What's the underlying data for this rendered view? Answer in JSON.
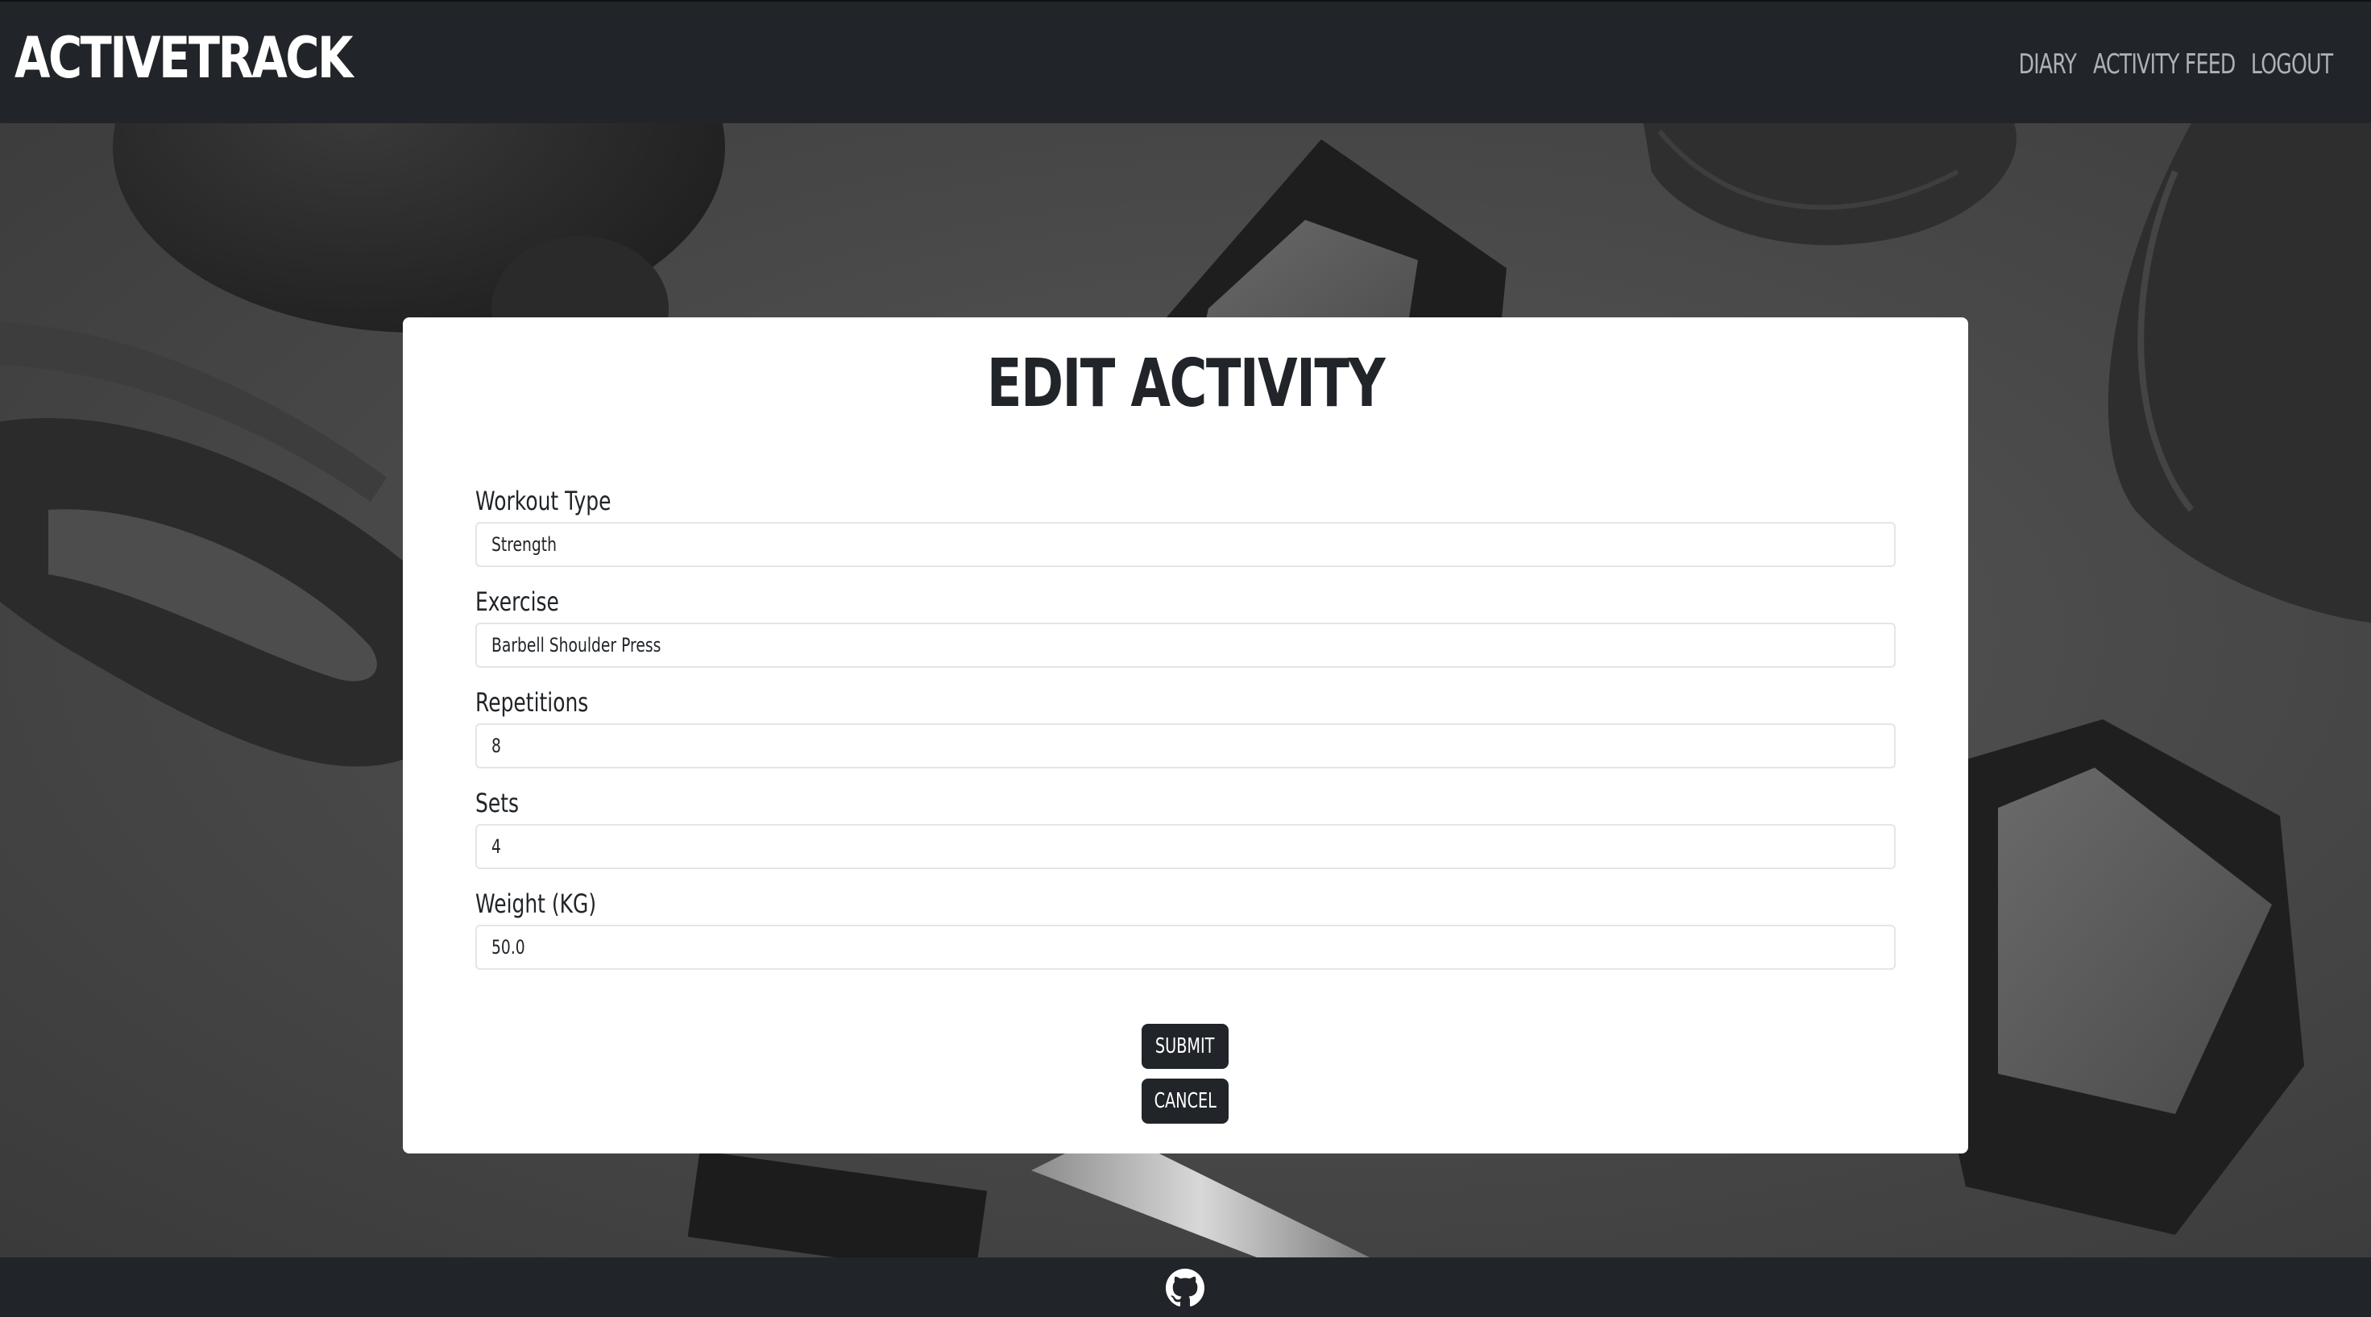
{
  "navbar": {
    "brand": "ACTIVETRACK",
    "links": [
      {
        "label": "DIARY"
      },
      {
        "label": "ACTIVITY FEED"
      },
      {
        "label": "LOGOUT"
      }
    ]
  },
  "form": {
    "title": "EDIT ACTIVITY",
    "fields": [
      {
        "label": "Workout Type",
        "value": "Strength"
      },
      {
        "label": "Exercise",
        "value": "Barbell Shoulder Press"
      },
      {
        "label": "Repetitions",
        "value": "8"
      },
      {
        "label": "Sets",
        "value": "4"
      },
      {
        "label": "Weight (KG)",
        "value": "50.0"
      }
    ],
    "submit_label": "SUBMIT",
    "cancel_label": "CANCEL"
  },
  "footer": {
    "icon": "github-icon"
  },
  "colors": {
    "navbar_bg": "#212529",
    "nav_link": "#aeb1b5",
    "button_bg": "#212529",
    "card_bg": "#ffffff"
  }
}
